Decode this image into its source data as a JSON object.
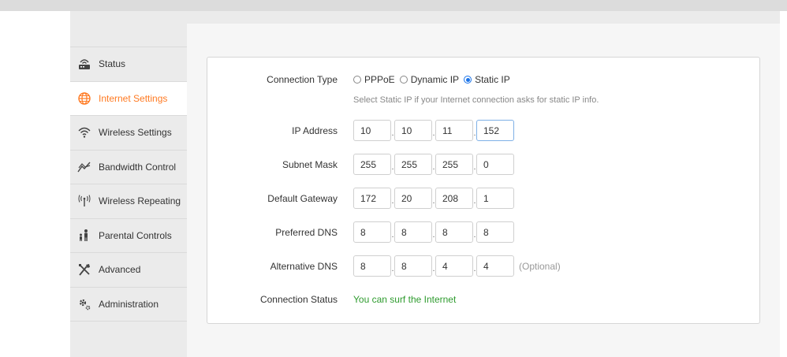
{
  "sidebar": {
    "items": [
      {
        "label": "Status",
        "icon": "router-icon"
      },
      {
        "label": "Internet Settings",
        "icon": "globe-icon",
        "active": true
      },
      {
        "label": "Wireless Settings",
        "icon": "wifi-icon"
      },
      {
        "label": "Bandwidth Control",
        "icon": "bandwidth-icon"
      },
      {
        "label": "Wireless Repeating",
        "icon": "antenna-icon"
      },
      {
        "label": "Parental Controls",
        "icon": "parental-icon"
      },
      {
        "label": "Advanced",
        "icon": "tools-icon"
      },
      {
        "label": "Administration",
        "icon": "gears-icon"
      }
    ],
    "active_color": "#ff7a22"
  },
  "form": {
    "connection_type": {
      "label": "Connection Type",
      "options": [
        "PPPoE",
        "Dynamic IP",
        "Static IP"
      ],
      "selected": "Static IP",
      "hint": "Select Static IP if your Internet connection asks for static IP info."
    },
    "ip_address": {
      "label": "IP Address",
      "octets": [
        "10",
        "10",
        "11",
        "152"
      ]
    },
    "subnet_mask": {
      "label": "Subnet Mask",
      "octets": [
        "255",
        "255",
        "255",
        "0"
      ]
    },
    "default_gateway": {
      "label": "Default Gateway",
      "octets": [
        "172",
        "20",
        "208",
        "1"
      ]
    },
    "preferred_dns": {
      "label": "Preferred DNS",
      "octets": [
        "8",
        "8",
        "8",
        "8"
      ]
    },
    "alternative_dns": {
      "label": "Alternative DNS",
      "octets": [
        "8",
        "8",
        "4",
        "4"
      ],
      "note": "(Optional)"
    },
    "connection_status": {
      "label": "Connection Status",
      "value": "You can surf the Internet",
      "color": "#2e9b2e"
    }
  }
}
